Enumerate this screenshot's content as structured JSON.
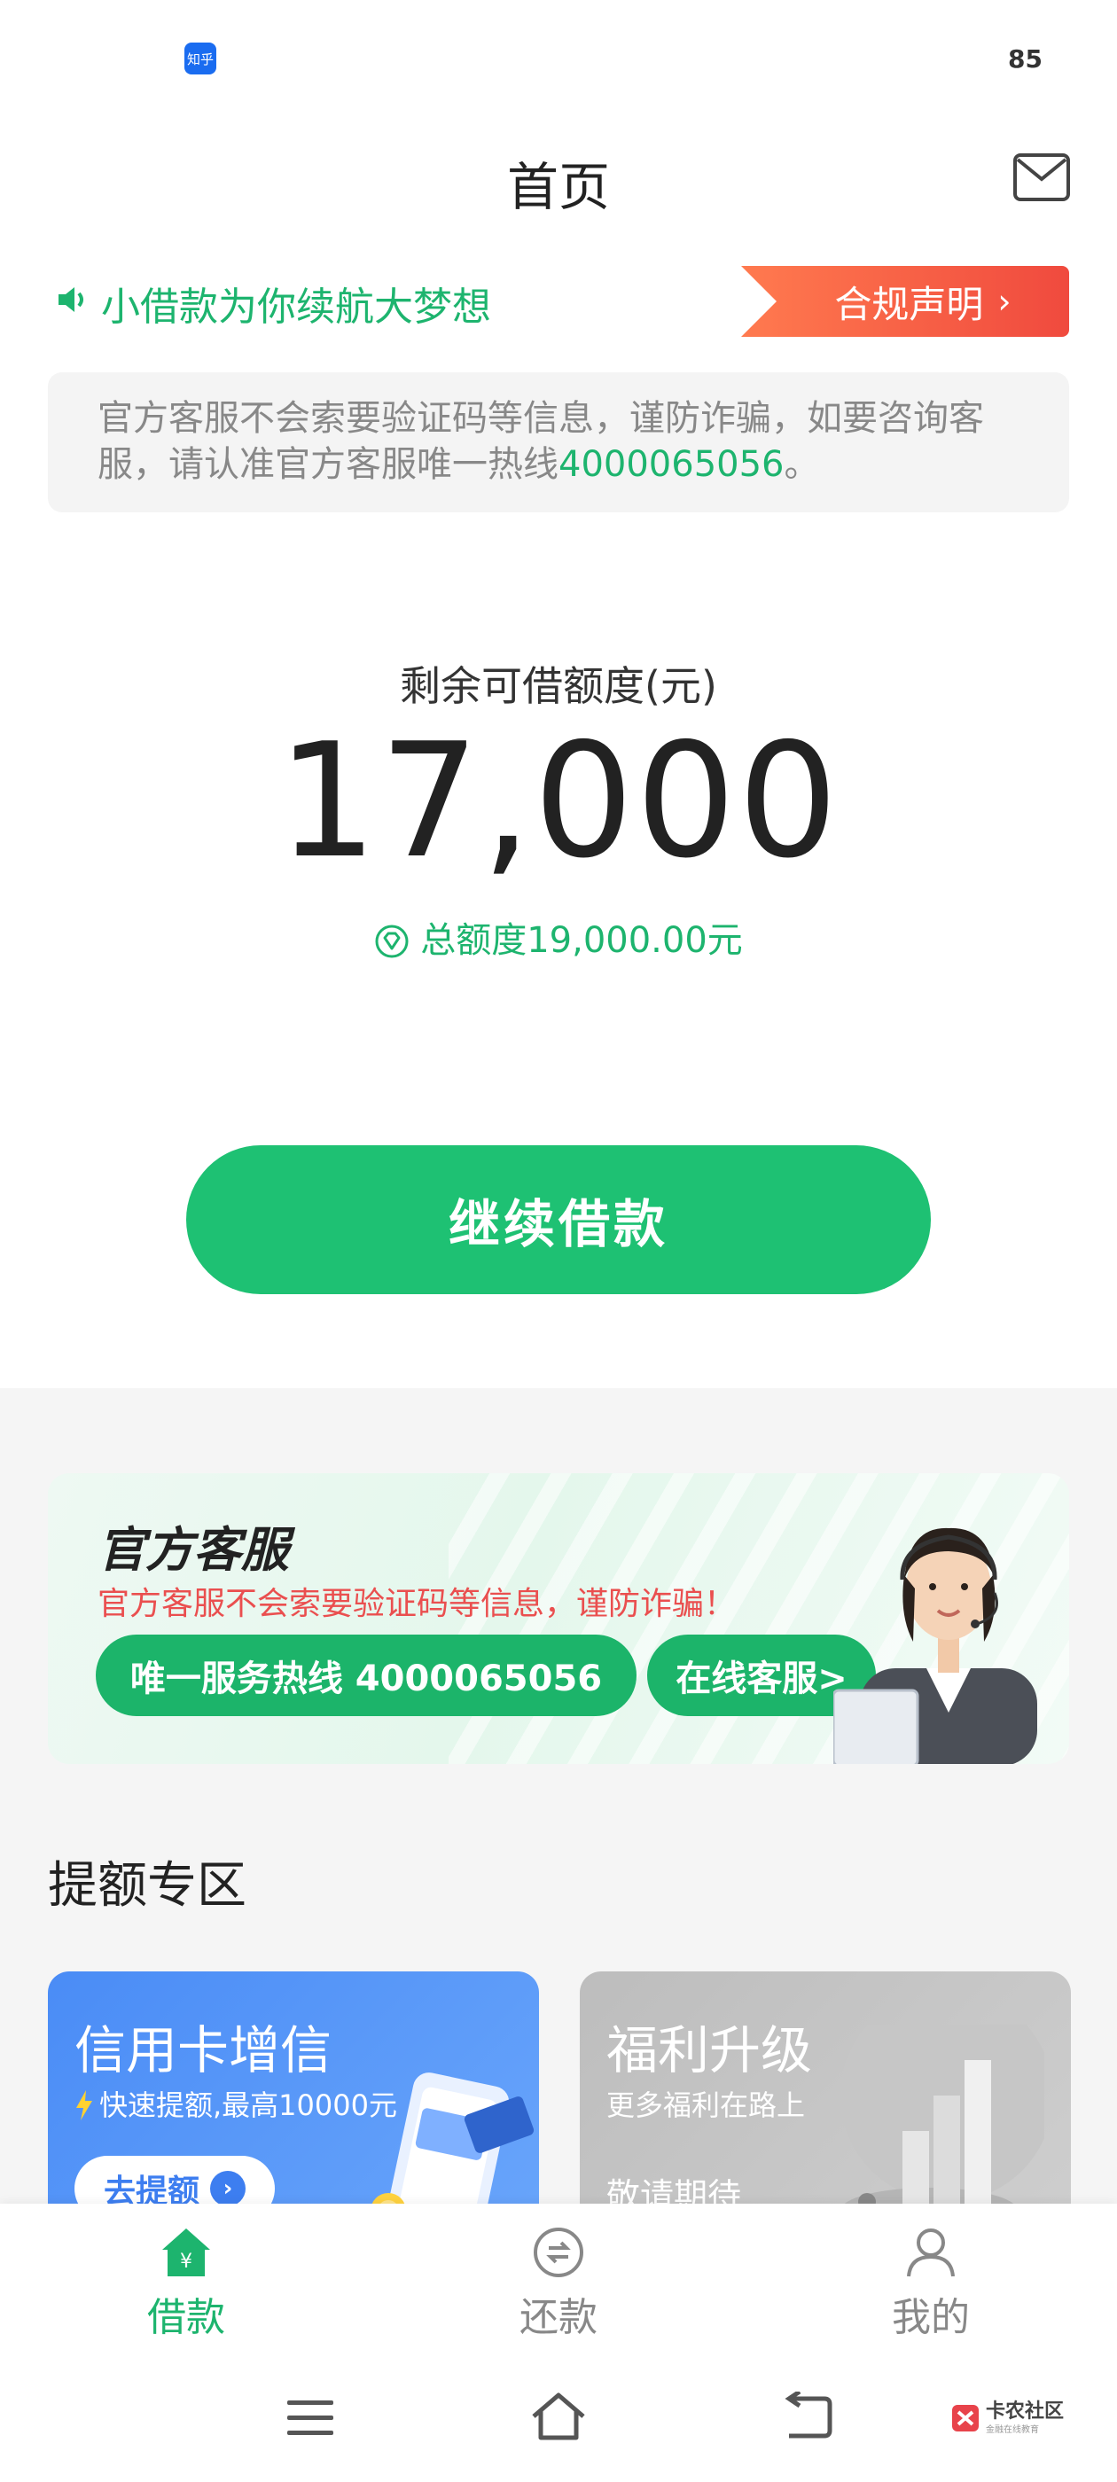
{
  "status_bar": {
    "app_badge": "知乎",
    "battery": "85"
  },
  "header": {
    "title": "首页",
    "mail_icon": "mail-icon"
  },
  "notice": {
    "slogan": "小借款为你续航大梦想",
    "compliance_button": "合规声明",
    "compliance_chevron": "›"
  },
  "warning": {
    "text": "官方客服不会索要验证码等信息，谨防诈骗，如要咨询客服，请认准官方客服唯一热线",
    "hotline": "4000065056",
    "suffix": "。"
  },
  "limit": {
    "label": "剩余可借额度(元)",
    "value": "17,000",
    "total": "总额度19,000.00元"
  },
  "main_button": "继续借款",
  "service_banner": {
    "title": "官方客服",
    "warning": "官方客服不会索要验证码等信息，谨防诈骗！",
    "hotline_button": "唯一服务热线 4000065056",
    "online_button": "在线客服>"
  },
  "section": {
    "title": "提额专区",
    "cards": [
      {
        "title": "信用卡增信",
        "subtitle": "快速提额,最高10000元",
        "action": "去提额"
      },
      {
        "title": "福利升级",
        "subtitle": "更多福利在路上",
        "action": "敬请期待"
      }
    ]
  },
  "tabs": [
    {
      "label": "借款",
      "icon": "home-yuan-icon",
      "active": true
    },
    {
      "label": "还款",
      "icon": "repay-icon",
      "active": false
    },
    {
      "label": "我的",
      "icon": "user-icon",
      "active": false
    }
  ],
  "nav": {
    "watermark": "卡农社区",
    "watermark_sub": "金融在线教育"
  },
  "colors": {
    "brand_green": "#1db46e",
    "alert_red": "#f04a3e",
    "card_blue": "#4a8cf6"
  }
}
